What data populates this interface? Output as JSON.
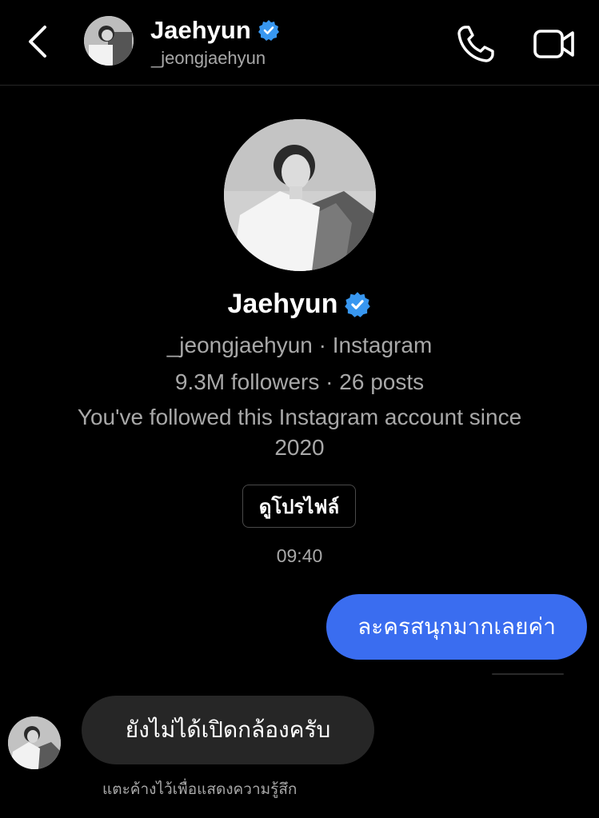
{
  "header": {
    "name": "Jaehyun",
    "username": "_jeongjaehyun"
  },
  "icons": {
    "back": "chevron-left-icon",
    "call": "phone-icon",
    "video": "video-camera-icon",
    "verified": "verified-badge-icon"
  },
  "profile": {
    "name": "Jaehyun",
    "handle_line": "_jeongjaehyun · Instagram",
    "stats_line": "9.3M followers · 26 posts",
    "follow_line_1": "You've followed this Instagram account since",
    "follow_line_2": "2020",
    "view_profile_label": "ดูโปรไฟล์"
  },
  "thread": {
    "timestamp": "09:40",
    "messages": [
      {
        "direction": "outgoing",
        "text": "ละครสนุกมากเลยค่า"
      },
      {
        "direction": "incoming",
        "text": "ยังไม่ได้เปิดกล้องครับ"
      }
    ],
    "react_hint": "แตะค้างไว้เพื่อแสดงความรู้สึก"
  },
  "colors": {
    "background": "#000000",
    "outgoing_bubble": "#3a6df0",
    "incoming_bubble": "#262626",
    "verified_blue": "#3897f0",
    "secondary_text": "#a8a8a8"
  }
}
